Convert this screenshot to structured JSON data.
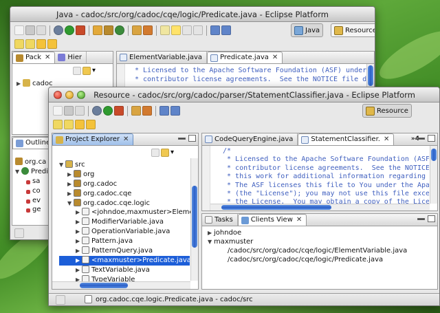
{
  "back_window": {
    "title": "Java - cadoc/src/org/cadoc/cqe/logic/Predicate.java - Eclipse Platform",
    "perspectives": [
      "Java",
      "Resource"
    ],
    "left_tabs": [
      "Pack",
      "Hier"
    ],
    "tree_root": "cadoc",
    "editor_tabs": [
      "ElementVariable.java",
      "Predicate.java"
    ],
    "code_lines": [
      "* Licensed to the Apache Software Foundation (ASF) under",
      "* contributor license agreements.  See the NOTICE file d"
    ],
    "outline_title": "Outline",
    "outline_items": [
      "org.ca",
      "Predi",
      "sa",
      "co",
      "ev",
      "ge"
    ]
  },
  "front_window": {
    "title": "Resource - cadoc/src/org/cadoc/parser/StatementClassifier.java - Eclipse Platform",
    "perspective": "Resource",
    "explorer": {
      "title": "Project Explorer",
      "items": [
        {
          "label": "src",
          "depth": 0,
          "twisty": "▼",
          "icon": "folder-icon",
          "color": "#d7b349"
        },
        {
          "label": "org",
          "depth": 1,
          "twisty": "▶",
          "icon": "package-icon",
          "color": "#b88a2e"
        },
        {
          "label": "org.cadoc",
          "depth": 1,
          "twisty": "▶",
          "icon": "package-icon",
          "color": "#b88a2e"
        },
        {
          "label": "org.cadoc.cqe",
          "depth": 1,
          "twisty": "▶",
          "icon": "package-icon",
          "color": "#b88a2e"
        },
        {
          "label": "org.cadoc.cqe.logic",
          "depth": 1,
          "twisty": "▼",
          "icon": "package-icon",
          "color": "#b88a2e"
        },
        {
          "label": "<johndoe,maxmuster>Element",
          "depth": 2,
          "twisty": "▶",
          "icon": "java-file-icon",
          "color": "#f2f2f2"
        },
        {
          "label": "ModifierVariable.java",
          "depth": 2,
          "twisty": "▶",
          "icon": "java-file-icon",
          "color": "#f2f2f2"
        },
        {
          "label": "OperationVariable.java",
          "depth": 2,
          "twisty": "▶",
          "icon": "java-file-icon",
          "color": "#f2f2f2"
        },
        {
          "label": "Pattern.java",
          "depth": 2,
          "twisty": "▶",
          "icon": "java-file-icon",
          "color": "#f2f2f2"
        },
        {
          "label": "PatternQuery.java",
          "depth": 2,
          "twisty": "▶",
          "icon": "java-file-icon",
          "color": "#f2f2f2"
        },
        {
          "label": "<maxmuster>Predicate.java",
          "depth": 2,
          "twisty": "▶",
          "icon": "java-file-icon",
          "color": "#f2f2f2",
          "selected": true
        },
        {
          "label": "TextVariable.java",
          "depth": 2,
          "twisty": "▶",
          "icon": "java-file-icon",
          "color": "#f2f2f2"
        },
        {
          "label": "TypeVariable",
          "depth": 2,
          "twisty": "▶",
          "icon": "java-file-icon",
          "color": "#f2f2f2"
        }
      ]
    },
    "editor": {
      "tabs": [
        "CodeQueryEngine.java",
        "StatementClassifier."
      ],
      "overflow": "»4",
      "lines": [
        "/*",
        " * Licensed to the Apache Software Foundation (ASF",
        " * contributor license agreements.  See the NOTICE",
        " * this work for additional information regarding",
        " * The ASF licenses this file to You under the Apa",
        " * (the \"License\"); you may not use this file exce",
        " * the License.  You may obtain a copy of the Lice"
      ]
    },
    "bottom": {
      "tabs": [
        "Tasks",
        "Clients View"
      ],
      "items": [
        {
          "twisty": "▶",
          "label": "johndoe",
          "indent": 0
        },
        {
          "twisty": "▼",
          "label": "maxmuster",
          "indent": 0
        },
        {
          "twisty": "",
          "label": "/cadoc/src/org/cadoc/cqe/logic/ElementVariable.java",
          "indent": 1
        },
        {
          "twisty": "",
          "label": "/cadoc/src/org/cadoc/cqe/logic/Predicate.java",
          "indent": 1
        }
      ]
    },
    "status_text": "org.cadoc.cqe.logic.Predicate.java - cadoc/src"
  }
}
